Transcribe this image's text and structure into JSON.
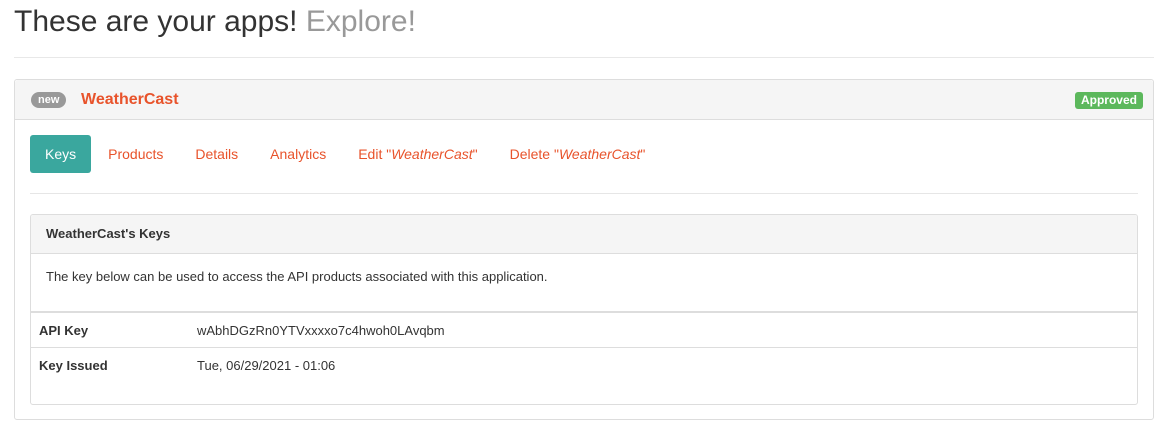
{
  "header": {
    "title": "These are your apps!",
    "subtitle": "Explore!"
  },
  "app": {
    "badge": "new",
    "name": "WeatherCast",
    "status": "Approved",
    "status_color": "#5cb85c",
    "accent_color": "#e8532b",
    "tabs": [
      {
        "label": "Keys",
        "active": true
      },
      {
        "label": "Products"
      },
      {
        "label": "Details"
      },
      {
        "label": "Analytics"
      },
      {
        "prefix": "Edit \"",
        "name": "WeatherCast",
        "suffix": "\""
      },
      {
        "prefix": "Delete \"",
        "name": "WeatherCast",
        "suffix": "\""
      }
    ],
    "active_tab_color": "#3aa79e"
  },
  "keys_panel": {
    "title": "WeatherCast's Keys",
    "description": "The key below can be used to access the API products associated with this application.",
    "rows": [
      {
        "label": "API Key",
        "value": "wAbhDGzRn0YTVxxxxo7c4hwoh0LAvqbm"
      },
      {
        "label": "Key Issued",
        "value": "Tue, 06/29/2021 - 01:06"
      }
    ]
  }
}
